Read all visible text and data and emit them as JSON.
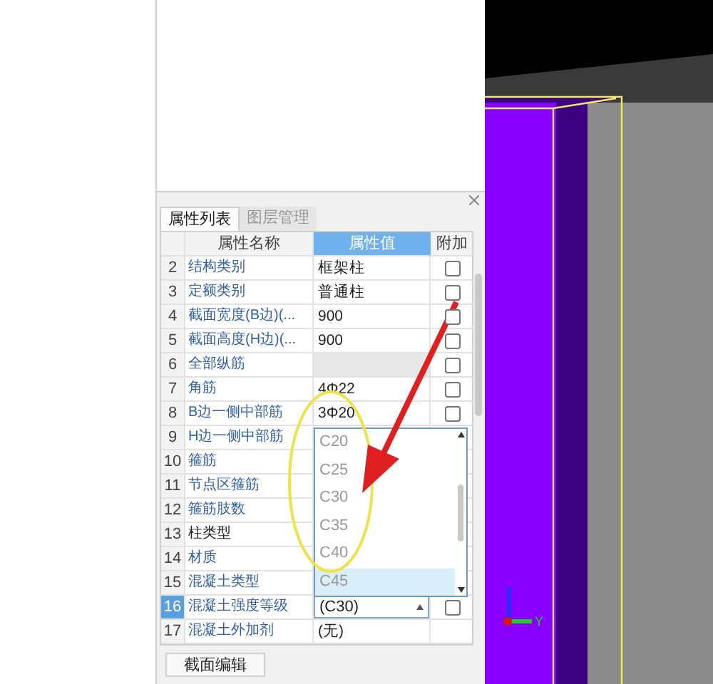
{
  "panel": {
    "tabs": [
      {
        "label": "属性列表",
        "selected": true
      },
      {
        "label": "图层管理",
        "selected": false
      }
    ],
    "columns": [
      "属性名称",
      "属性值",
      "附加"
    ],
    "rows": [
      {
        "number": "2",
        "name": "结构类别",
        "color": "#2f5fa8",
        "kind": "text",
        "value": "框架柱",
        "checked": false,
        "selected": false
      },
      {
        "number": "3",
        "name": "定额类别",
        "color": "#2f5fa8",
        "kind": "text",
        "value": "普通柱",
        "checked": false,
        "selected": false
      },
      {
        "number": "4",
        "name": "截面宽度(B边)(...",
        "color": "#2f5fa8",
        "kind": "text",
        "value": "900",
        "checked": false,
        "selected": false
      },
      {
        "number": "5",
        "name": "截面高度(H边)(...",
        "color": "#2f5fa8",
        "kind": "text",
        "value": "900",
        "checked": false,
        "selected": false
      },
      {
        "number": "6",
        "name": "全部纵筋",
        "color": "#2f5fa8",
        "kind": "empty",
        "checked": false,
        "selected": false
      },
      {
        "number": "7",
        "name": "角筋",
        "color": "#2f5fa8",
        "kind": "text",
        "value": "4Φ22",
        "checked": false,
        "selected": false
      },
      {
        "number": "8",
        "name": "B边一侧中部筋",
        "color": "#2f5fa8",
        "kind": "text",
        "value": "3Φ20",
        "checked": false,
        "selected": false
      },
      {
        "number": "9",
        "name": "H边一侧中部筋",
        "color": "#2f5fa8",
        "kind": "hidden",
        "selected": false
      },
      {
        "number": "10",
        "name": "箍筋",
        "color": "#2f5fa8",
        "kind": "hidden",
        "selected": false
      },
      {
        "number": "11",
        "name": "节点区箍筋",
        "color": "#2f5fa8",
        "kind": "hidden",
        "selected": false
      },
      {
        "number": "12",
        "name": "箍筋肢数",
        "color": "#2f5fa8",
        "kind": "hidden",
        "selected": false
      },
      {
        "number": "13",
        "name": "柱类型",
        "color": "#222222",
        "kind": "hidden",
        "selected": false
      },
      {
        "number": "14",
        "name": "材质",
        "color": "#2f5fa8",
        "kind": "hidden",
        "selected": false
      },
      {
        "number": "15",
        "name": "混凝土类型",
        "color": "#2f5fa8",
        "kind": "hidden",
        "selected": false
      },
      {
        "number": "16",
        "name": "混凝土强度等级",
        "color": "#2f5fa8",
        "kind": "combo",
        "value": "(C30)",
        "checked": false,
        "selected": true
      },
      {
        "number": "17",
        "name": "混凝土外加剂",
        "color": "#2f5fa8",
        "kind": "text",
        "value": "(无)",
        "selected": false
      }
    ],
    "dropdown": {
      "options": [
        {
          "label": "C20",
          "selected": false
        },
        {
          "label": "C25",
          "selected": false
        },
        {
          "label": "C30",
          "selected": false
        },
        {
          "label": "C35",
          "selected": false
        },
        {
          "label": "C40",
          "selected": false
        },
        {
          "label": "C45",
          "selected": true
        }
      ]
    },
    "button": "截面编辑"
  },
  "viewport": {
    "axis_label": "Y"
  }
}
